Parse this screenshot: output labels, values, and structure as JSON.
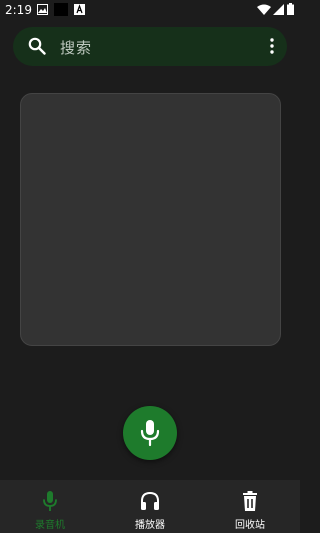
{
  "statusbar": {
    "time": "2:19"
  },
  "search": {
    "placeholder": "搜索",
    "icon": "search-icon",
    "menu_icon": "more-vert-icon"
  },
  "main": {
    "record_button_icon": "microphone-icon"
  },
  "bottom_nav": {
    "items": [
      {
        "label": "录音机",
        "icon": "microphone-icon",
        "active": true
      },
      {
        "label": "播放器",
        "icon": "headphones-icon",
        "active": false
      },
      {
        "label": "回收站",
        "icon": "trash-icon",
        "active": false
      }
    ]
  },
  "colors": {
    "background": "#1c1c1c",
    "search_bg": "#16301a",
    "card_bg": "#333333",
    "accent": "#1e7b2c",
    "nav_bg": "#262626"
  }
}
